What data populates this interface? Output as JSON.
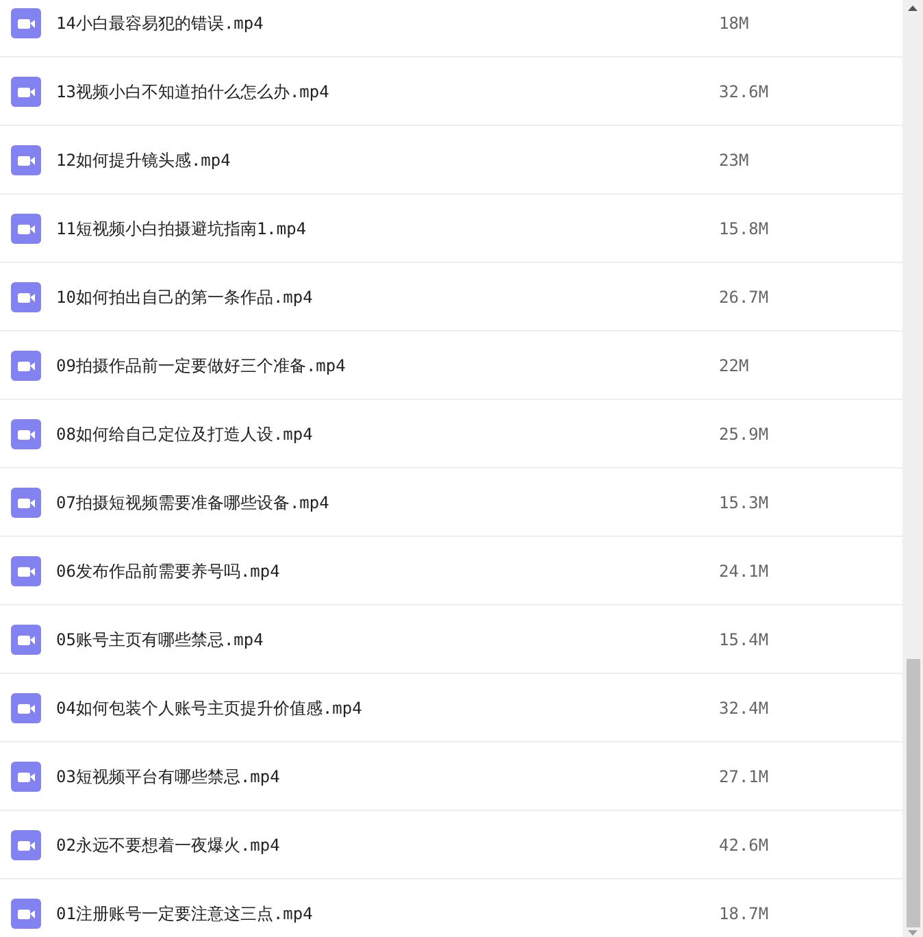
{
  "files": [
    {
      "name": "14小白最容易犯的错误.mp4",
      "size": "18M"
    },
    {
      "name": "13视频小白不知道拍什么怎么办.mp4",
      "size": "32.6M"
    },
    {
      "name": "12如何提升镜头感.mp4",
      "size": "23M"
    },
    {
      "name": "11短视频小白拍摄避坑指南1.mp4",
      "size": "15.8M"
    },
    {
      "name": "10如何拍出自己的第一条作品.mp4",
      "size": "26.7M"
    },
    {
      "name": "09拍摄作品前一定要做好三个准备.mp4",
      "size": "22M"
    },
    {
      "name": "08如何给自己定位及打造人设.mp4",
      "size": "25.9M"
    },
    {
      "name": "07拍摄短视频需要准备哪些设备.mp4",
      "size": "15.3M"
    },
    {
      "name": "06发布作品前需要养号吗.mp4",
      "size": "24.1M"
    },
    {
      "name": "05账号主页有哪些禁忌.mp4",
      "size": "15.4M"
    },
    {
      "name": "04如何包装个人账号主页提升价值感.mp4",
      "size": "32.4M"
    },
    {
      "name": "03短视频平台有哪些禁忌.mp4",
      "size": "27.1M"
    },
    {
      "name": "02永远不要想着一夜爆火.mp4",
      "size": "42.6M"
    },
    {
      "name": "01注册账号一定要注意这三点.mp4",
      "size": "18.7M"
    }
  ]
}
